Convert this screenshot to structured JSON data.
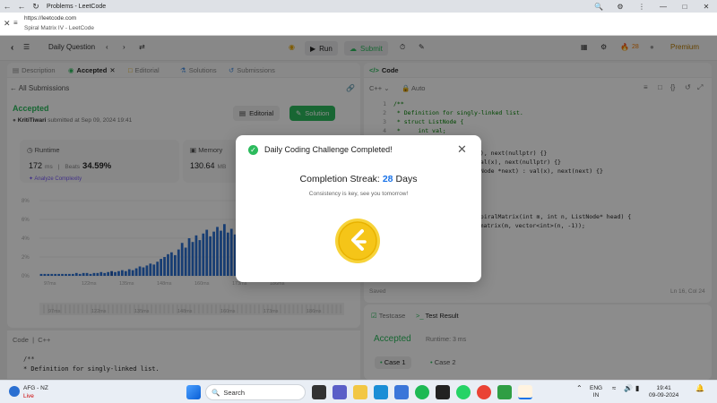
{
  "browser": {
    "tab_title": "Problems - LeetCode",
    "url": "https://leetcode.com",
    "page_label": "Spiral Matrix IV - LeetCode"
  },
  "nav": {
    "problem_list": "Daily Question",
    "run": "Run",
    "submit": "Submit",
    "streak_count": "28",
    "premium": "Premium"
  },
  "left_tabs": [
    "Description",
    "Accepted",
    "Editorial",
    "Solutions",
    "Submissions"
  ],
  "submission": {
    "back_label": "All Submissions",
    "status": "Accepted",
    "user": "KritiTiwari",
    "submitted_at": "submitted at Sep 09, 2024 19:41",
    "editorial_btn": "Editorial",
    "solution_btn": "Solution",
    "runtime_label": "Runtime",
    "runtime_value": "172",
    "runtime_unit": "ms",
    "beats_label": "Beats",
    "runtime_beats": "34.59%",
    "memory_label": "Memory",
    "memory_value": "130.64",
    "memory_unit": "MB",
    "analyze": "Analyze Complexity"
  },
  "chart_data": {
    "type": "bar",
    "ylim": [
      0,
      8
    ],
    "yticks": [
      "8%",
      "6%",
      "4%",
      "2%",
      "0%"
    ],
    "xticks": [
      "97ms",
      "122ms",
      "135ms",
      "148ms",
      "160ms",
      "173ms",
      "186ms"
    ],
    "mini_xticks": [
      "97ms",
      "122ms",
      "135ms",
      "148ms",
      "160ms",
      "173ms",
      "186ms"
    ],
    "values": [
      0.2,
      0.2,
      0.2,
      0.2,
      0.2,
      0.2,
      0.2,
      0.2,
      0.2,
      0.2,
      0.3,
      0.2,
      0.3,
      0.3,
      0.2,
      0.3,
      0.3,
      0.4,
      0.3,
      0.4,
      0.5,
      0.4,
      0.5,
      0.6,
      0.5,
      0.7,
      0.6,
      0.8,
      1.0,
      0.9,
      1.1,
      1.3,
      1.2,
      1.5,
      1.8,
      2.0,
      2.3,
      2.5,
      2.2,
      2.8,
      3.5,
      3.0,
      4.0,
      3.6,
      4.3,
      3.8,
      4.5,
      4.9,
      4.2,
      4.7,
      5.2,
      4.8,
      5.5,
      4.6,
      5.0,
      4.4,
      4.1,
      3.6
    ],
    "highlight_index": 20
  },
  "left_code": {
    "header": "Code",
    "lang": "C++",
    "lines": [
      "/**",
      " * Definition for singly-linked list."
    ]
  },
  "editor": {
    "title": "Code",
    "lang": "C++",
    "auto": "Auto",
    "lines": [
      {
        "n": "1",
        "t": "/**",
        "cls": "cm"
      },
      {
        "n": "2",
        "t": " * Definition for singly-linked list.",
        "cls": "cm"
      },
      {
        "n": "3",
        "t": " * struct ListNode {",
        "cls": "cm"
      },
      {
        "n": "4",
        "t": " *     int val;",
        "cls": "cm"
      }
    ],
    "hidden_lines": [
      "0), next(nullptr) {}",
      "val(x), next(nullptr) {}",
      "tNode *next) : val(x), next(next) {}",
      "spiralMatrix(int m, int n, ListNode* head) {",
      "nt>> matrix(m, vector<int>(n, -1));"
    ],
    "saved": "Saved",
    "cursor": "Ln 16, Col 24"
  },
  "results": {
    "testcase_tab": "Testcase",
    "result_tab": "Test Result",
    "status": "Accepted",
    "runtime": "Runtime: 3 ms",
    "case1": "Case 1",
    "case2": "Case 2"
  },
  "modal": {
    "title": "Daily Coding Challenge Completed!",
    "streak_prefix": "Completion Streak:",
    "streak_value": "28",
    "streak_suffix": "Days",
    "subtitle": "Consistency is key, see you tomorrow!"
  },
  "taskbar": {
    "weather_line1": "AFG - NZ",
    "weather_line2": "Live",
    "search": "Search",
    "lang1": "ENG",
    "lang2": "IN",
    "time": "19:41",
    "date": "09-09-2024"
  },
  "colors": {
    "accent_green": "#2cbb5d",
    "bar_blue": "#2a6fd1",
    "streak_blue": "#1a73e8",
    "coin_gold": "#f5c518"
  }
}
